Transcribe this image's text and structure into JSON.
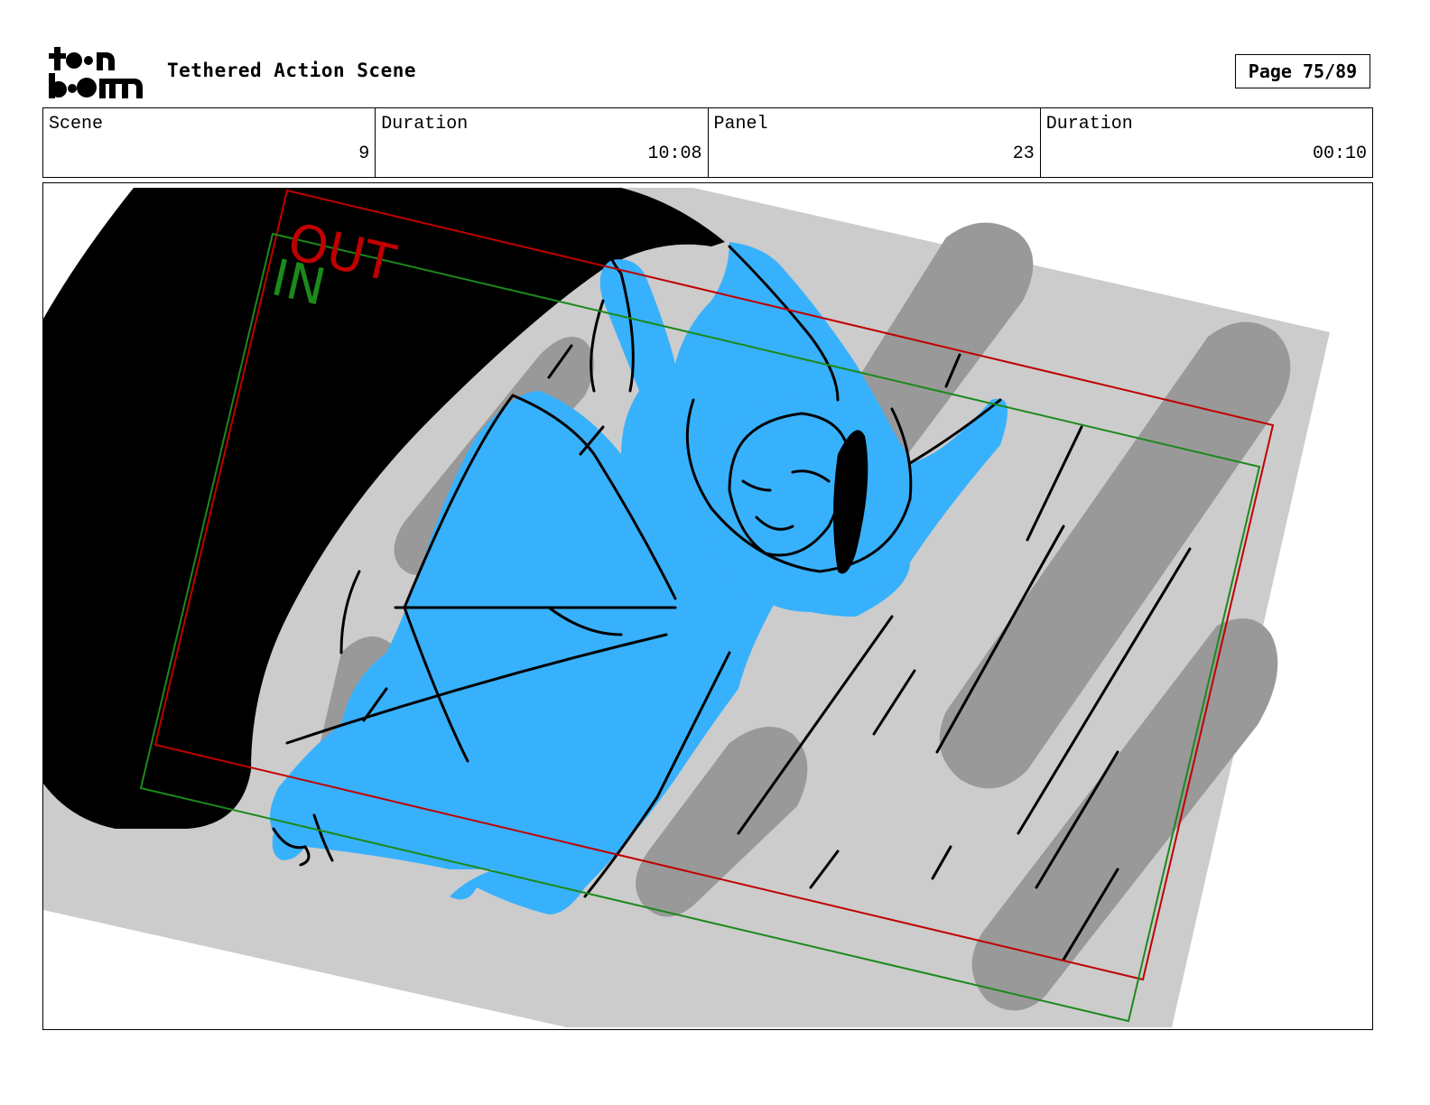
{
  "header": {
    "logo_text": "toonboom",
    "title": "Tethered Action Scene",
    "page": "Page 75/89"
  },
  "info": [
    {
      "label": "Scene",
      "value": "9"
    },
    {
      "label": "Duration",
      "value": "10:08"
    },
    {
      "label": "Panel",
      "value": "23"
    },
    {
      "label": "Duration",
      "value": "00:10"
    }
  ],
  "frame": {
    "out_label": "OUT",
    "in_label": "IN",
    "colors": {
      "character_fill": "#38b1fc",
      "out_frame": "#c00000",
      "in_frame": "#1b8a1b",
      "background_gray": "#cccccc",
      "shadow_gray": "#999999"
    }
  }
}
